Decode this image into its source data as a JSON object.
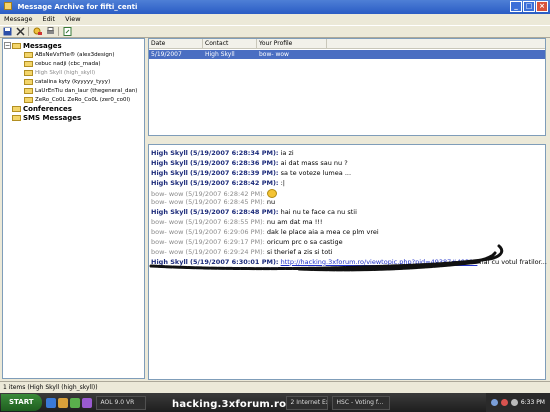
{
  "window": {
    "title": "Message Archive for fifti_centi"
  },
  "menu": [
    "Message",
    "Edit",
    "View"
  ],
  "toolbar": [
    "save-icon",
    "delete-icon",
    "find-icon",
    "print-icon",
    "export-icon"
  ],
  "tree": {
    "messages_label": "Messages",
    "contacts": [
      {
        "label": "ABsNeVsfYle® (alex3design)",
        "grey": false
      },
      {
        "label": "cebuc nadji (cbc_mada)",
        "grey": false
      },
      {
        "label": "High Skyll (high_skyll)",
        "grey": true
      },
      {
        "label": "catalina kyty (kyyyyy_tyyy)",
        "grey": false
      },
      {
        "label": "LaUrEnTiu dan_laur (thegeneral_dan)",
        "grey": false
      },
      {
        "label": "ZeRo_Co0L ZeRo_Co0L (zer0_co0l)",
        "grey": false
      }
    ],
    "conferences_label": "Conferences",
    "sms_label": "SMS Messages"
  },
  "grid": {
    "columns": [
      "Date",
      "Contact",
      "Your Profile"
    ],
    "rows": [
      {
        "date": "5/19/2007",
        "contact": "High Skyll",
        "profile": "bow- wow"
      }
    ]
  },
  "chat": [
    {
      "speaker": "High Skyll",
      "time": "(5/19/2007 6:28:34 PM):",
      "text": "ia zi",
      "kind": "h"
    },
    {
      "speaker": "High Skyll",
      "time": "(5/19/2007 6:28:36 PM):",
      "text": "ai dat mass sau nu ?",
      "kind": "h"
    },
    {
      "speaker": "High Skyll",
      "time": "(5/19/2007 6:28:39 PM):",
      "text": "sa te voteze lumea ...",
      "kind": "h"
    },
    {
      "speaker": "High Skyll",
      "time": "(5/19/2007 6:28:42 PM):",
      "text": ":|",
      "kind": "h"
    },
    {
      "speaker": "bow- wow",
      "time": "(5/19/2007 6:28:42 PM):",
      "text": "",
      "kind": "b",
      "smiley": true
    },
    {
      "speaker": "bow- wow",
      "time": "(5/19/2007 6:28:45 PM):",
      "text": "nu",
      "kind": "b"
    },
    {
      "speaker": "High Skyll",
      "time": "(5/19/2007 6:28:48 PM):",
      "text": "hai nu te face ca nu stii",
      "kind": "h"
    },
    {
      "speaker": "bow- wow",
      "time": "(5/19/2007 6:28:55 PM):",
      "text": "nu am dat ma !!!",
      "kind": "b"
    },
    {
      "speaker": "bow- wow",
      "time": "(5/19/2007 6:29:06 PM):",
      "text": "dak le place aia a mea ce plm vrei",
      "kind": "b"
    },
    {
      "speaker": "bow- wow",
      "time": "(5/19/2007 6:29:17 PM):",
      "text": "oricum prc o sa castige",
      "kind": "b"
    },
    {
      "speaker": "bow- wow",
      "time": "(5/19/2007 6:29:24 PM):",
      "text": "si therief a zis si toti",
      "kind": "b"
    },
    {
      "speaker": "High Skyll",
      "time": "(5/19/2007 6:30:01 PM):",
      "text": "hai cu votul fratilor...",
      "kind": "h",
      "link": "http://hacking.3xforum.ro/viewtopic.php?pid=49387#49387"
    }
  ],
  "status": "1 items (High Skyll (high_skyll))",
  "taskbar": {
    "start_label": "START",
    "buttons": [
      "AOL 9.0 VR",
      "2 Internet Ex...",
      "HSC - Voting f..."
    ],
    "clock": "6:33 PM"
  },
  "watermark": "hacking.3xforum.ro",
  "colors": {
    "selection": "#4a6ec2",
    "speaker_high": "#1b2a7a",
    "speaker_bow": "#8a8a8a",
    "link": "#1f30c8"
  }
}
